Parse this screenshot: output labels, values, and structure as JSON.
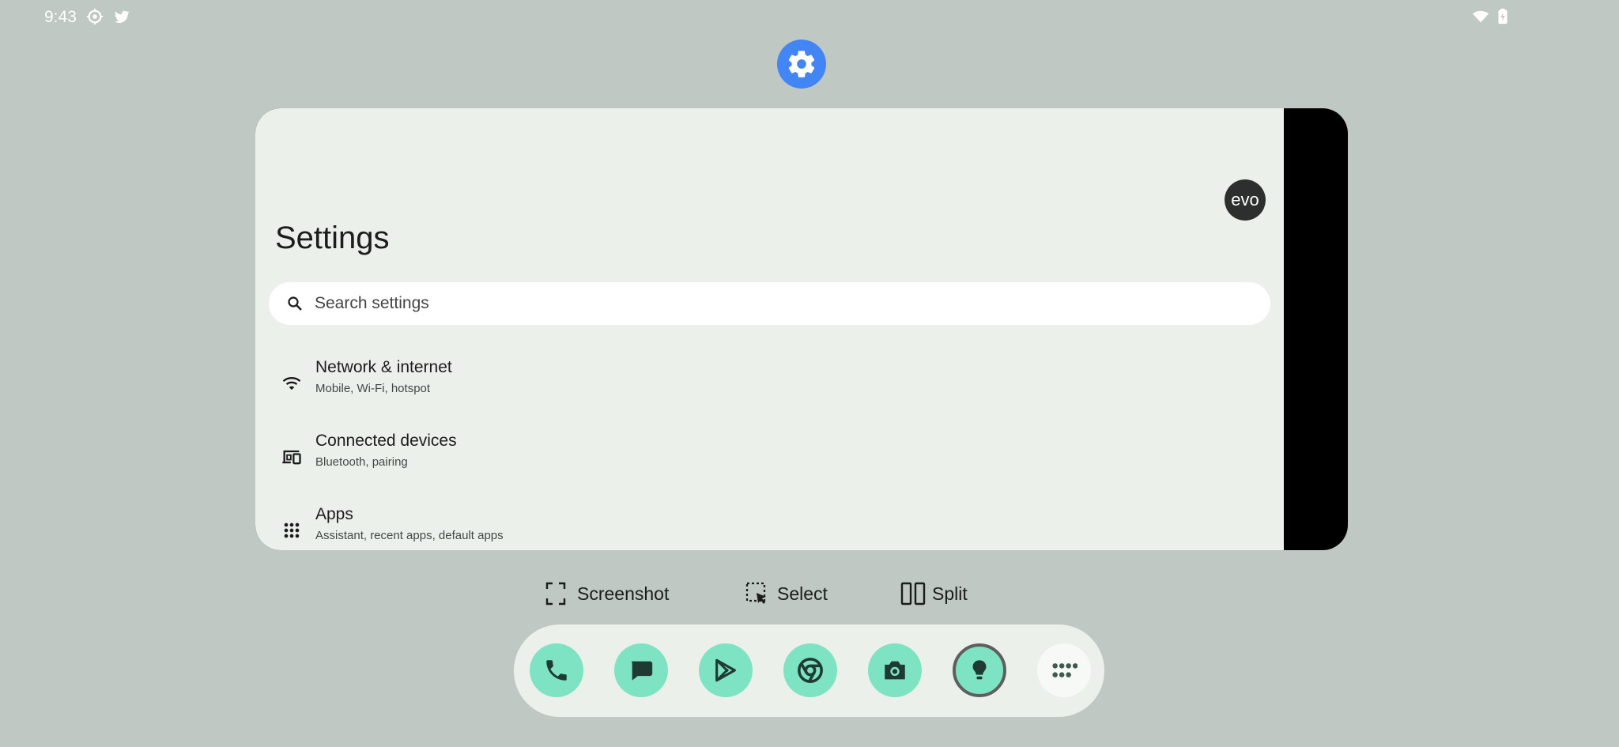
{
  "status_bar": {
    "time": "9:43",
    "left_icons": [
      "settings-gear-icon",
      "twitter-icon"
    ],
    "right_icons": [
      "wifi-icon",
      "battery-icon"
    ]
  },
  "recent_app": {
    "icon": "settings-icon",
    "icon_color": "#4285f4",
    "avatar_text": "evo",
    "title": "Settings",
    "search_placeholder": "Search settings",
    "items": [
      {
        "icon": "wifi-icon",
        "title": "Network & internet",
        "subtitle": "Mobile, Wi-Fi, hotspot"
      },
      {
        "icon": "connected-devices-icon",
        "title": "Connected devices",
        "subtitle": "Bluetooth, pairing"
      },
      {
        "icon": "apps-grid-icon",
        "title": "Apps",
        "subtitle": "Assistant, recent apps, default apps"
      }
    ]
  },
  "actions": {
    "screenshot": "Screenshot",
    "select": "Select",
    "split": "Split"
  },
  "dock": {
    "accent": "#7de3c2",
    "apps": [
      "phone-icon",
      "messages-icon",
      "play-store-icon",
      "chrome-icon",
      "camera-icon",
      "keep-notes-icon",
      "app-drawer-icon"
    ]
  }
}
